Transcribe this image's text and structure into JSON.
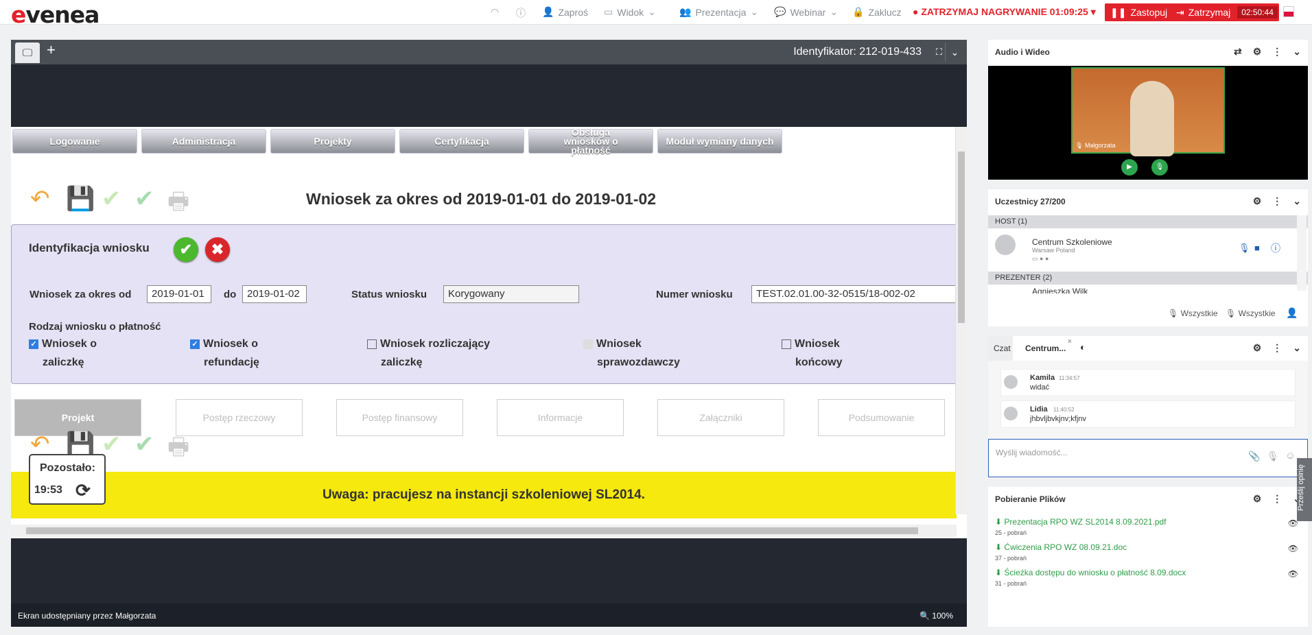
{
  "topbar": {
    "logo": "evenea",
    "menu": [
      {
        "label": "Zaproś",
        "icon": "add-user-icon"
      },
      {
        "label": "Widok",
        "icon": "layout-icon"
      },
      {
        "label": "Prezentacja",
        "icon": "presentation-icon"
      },
      {
        "label": "Webinar",
        "icon": "chat-icon"
      },
      {
        "label": "Zaklucz",
        "icon": "lock-icon"
      }
    ],
    "recording": "ZATRZYMAJ NAGRYWANIE 01:09:25",
    "replace_label": "Zastopuj",
    "stop_label": "Zatrzymaj",
    "stop_timer": "02:50:44"
  },
  "share": {
    "identifier": "Identyfikator: 212-019-433",
    "footer_label": "Ekran udostępniany przez Małgorzata",
    "zoom": "100%"
  },
  "app": {
    "nav": [
      "Logowanie",
      "Administracja",
      "Projekty",
      "Certyfikacja",
      "Obsługa wniosków o płatność",
      "Moduł wymiany danych"
    ],
    "title": "Wniosek za okres od 2019-01-01 do 2019-01-02",
    "ident_title": "Identyfikacja wniosku",
    "period_label": "Wniosek za okres od",
    "period_from": "2019-01-01",
    "period_to_label": "do",
    "period_to": "2019-01-02",
    "status_label": "Status wniosku",
    "status_value": "Korygowany",
    "number_label": "Numer wniosku",
    "number_value": "TEST.02.01.00-32-0515/18-002-02",
    "type_label": "Rodzaj wniosku o płatność",
    "types": [
      {
        "line1": "Wniosek o",
        "line2": "zaliczkę",
        "checked": true
      },
      {
        "line1": "Wniosek o",
        "line2": "refundację",
        "checked": true
      },
      {
        "line1": "Wniosek rozliczający",
        "line2": "zaliczkę",
        "checked": false
      },
      {
        "line1": "Wniosek",
        "line2": "sprawozdawczy",
        "checked": false
      },
      {
        "line1": "Wniosek",
        "line2": "końcowy",
        "checked": false
      }
    ],
    "tabs": [
      "Projekt",
      "Postęp rzeczowy",
      "Postęp finansowy",
      "Informacje",
      "Załączniki",
      "Podsumowanie"
    ],
    "remaining_label": "Pozostało:",
    "remaining_value": "19:53",
    "warning": "Uwaga: pracujesz na instancji szkoleniowej SL2014."
  },
  "av_panel": {
    "title": "Audio i Wideo",
    "speaker": "Małgorzata"
  },
  "participants": {
    "title": "Uczestnicy 27/200",
    "host_group": "HOST (1)",
    "host_name": "Centrum Szkoleniowe",
    "host_location": "Warsaw Poland",
    "presenter_group": "PREZENTER (2)",
    "presenter_name": "Agnieszka Wilk",
    "mute_all": "Wszystkie",
    "unmute_all": "Wszystkie"
  },
  "chat": {
    "tab_chat": "Czat",
    "tab_private": "Centrum...",
    "messages": [
      {
        "name": "Kamila",
        "time": "11:34:57",
        "text": "widać"
      },
      {
        "name": "Lidia",
        "time": "11:40:52",
        "text": "jhbvljbvkjnv;kfjnv"
      }
    ],
    "placeholder": "Wyślij wiadomość...",
    "feedback": "Prześlij opinię"
  },
  "downloads": {
    "title": "Pobieranie Plików",
    "files": [
      {
        "name": "Prezentacja RPO WZ SL2014 8.09.2021.pdf",
        "count": "25 - pobrań"
      },
      {
        "name": "Ćwiczenia RPO WZ 08.09.21.doc",
        "count": "37 - pobrań"
      },
      {
        "name": "Ścieżka dostępu do wniosku o płatność 8.09.docx",
        "count": "31 - pobrań"
      }
    ]
  }
}
